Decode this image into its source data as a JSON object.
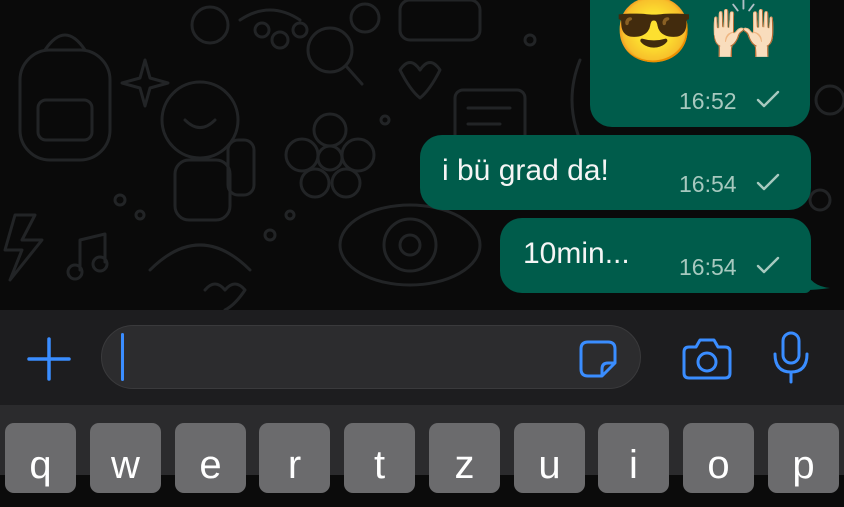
{
  "messages": [
    {
      "emojis": [
        "😎",
        "🙌🏻"
      ],
      "time": "16:52",
      "status": "read-ticks"
    },
    {
      "text": "i bü grad da!",
      "time": "16:54",
      "status": "read-ticks"
    },
    {
      "text": "10min...",
      "time": "16:54",
      "status": "read-ticks"
    }
  ],
  "input": {
    "value": "",
    "placeholder": ""
  },
  "icons": {
    "add": "plus-icon",
    "sticker": "sticker-icon",
    "camera": "camera-icon",
    "mic": "microphone-icon"
  },
  "keyboard": {
    "row1": [
      "q",
      "w",
      "e",
      "r",
      "t",
      "z",
      "u",
      "i",
      "o",
      "p"
    ]
  },
  "colors": {
    "bubble": "#005c4b",
    "accent": "#3a8dff",
    "background": "#0a0a0a",
    "inputbar": "#1d1d1f",
    "key": "#6b6b6d"
  }
}
